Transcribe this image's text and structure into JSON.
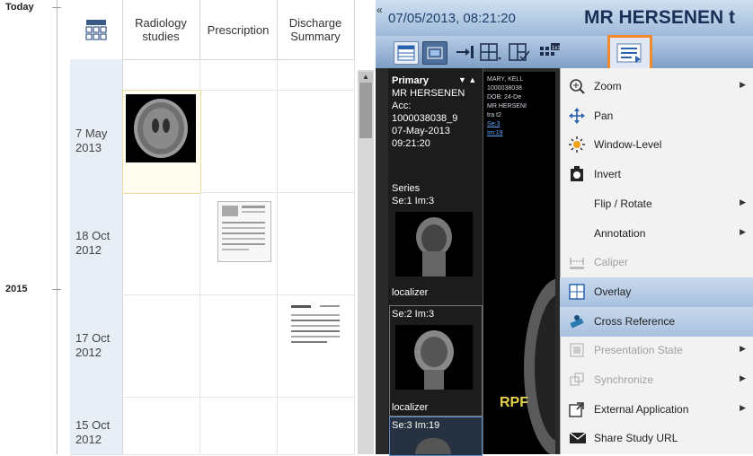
{
  "timeline": {
    "today_label": "Today",
    "year_label": "2015"
  },
  "columns": [
    "Radiology\nstudies",
    "Prescription",
    "Discharge\nSummary"
  ],
  "rows": [
    {
      "date": "7 May\n2013"
    },
    {
      "date": "18 Oct\n2012"
    },
    {
      "date": "17 Oct\n2012"
    },
    {
      "date": "15 Oct\n2012"
    }
  ],
  "viewer": {
    "datetime": "07/05/2013, 08:21:20",
    "patient_title": "MR HERSENEN t",
    "collapse_glyph": "«"
  },
  "thumb_panel": {
    "primary": "Primary",
    "study": "MR HERSENEN",
    "acc": "Acc:",
    "acc_no": "1000038038_9",
    "date": "07-May-2013",
    "time": "09:21:20",
    "series": "Series",
    "s1": "Se:1  Im:3",
    "s1_label": "localizer",
    "s2": "Se:2  Im:3",
    "s2_label": "localizer",
    "s3": "Se:3  Im:19"
  },
  "overlay_info": [
    "MARY, KELL",
    "1000038038",
    "DOB: 24-De",
    "MR HERSENI",
    "tra t2",
    "Se:3",
    "Im:19"
  ],
  "orientation_label": "RPF",
  "menu": {
    "items": [
      {
        "label": "Zoom",
        "icon": "zoom-icon",
        "arrow": true,
        "state": "normal"
      },
      {
        "label": "Pan",
        "icon": "pan-icon",
        "arrow": false,
        "state": "normal"
      },
      {
        "label": "Window-Level",
        "icon": "window-level-icon",
        "arrow": false,
        "state": "normal"
      },
      {
        "label": "Invert",
        "icon": "invert-icon",
        "arrow": false,
        "state": "normal"
      },
      {
        "label": "Flip / Rotate",
        "icon": "",
        "arrow": true,
        "state": "normal"
      },
      {
        "label": "Annotation",
        "icon": "",
        "arrow": true,
        "state": "normal"
      },
      {
        "label": "Caliper",
        "icon": "caliper-icon",
        "arrow": false,
        "state": "disabled"
      },
      {
        "label": "Overlay",
        "icon": "overlay-icon",
        "arrow": false,
        "state": "highlighted"
      },
      {
        "label": "Cross Reference",
        "icon": "cross-reference-icon",
        "arrow": false,
        "state": "highlighted"
      },
      {
        "label": "Presentation State",
        "icon": "presentation-state-icon",
        "arrow": true,
        "state": "disabled"
      },
      {
        "label": "Synchronize",
        "icon": "synchronize-icon",
        "arrow": true,
        "state": "disabled"
      },
      {
        "label": "External Application",
        "icon": "external-app-icon",
        "arrow": true,
        "state": "normal"
      },
      {
        "label": "Share Study URL",
        "icon": "share-url-icon",
        "arrow": false,
        "state": "normal"
      }
    ]
  },
  "colors": {
    "highlight_box": "#f08a2c",
    "accent": "#2a63b0"
  }
}
